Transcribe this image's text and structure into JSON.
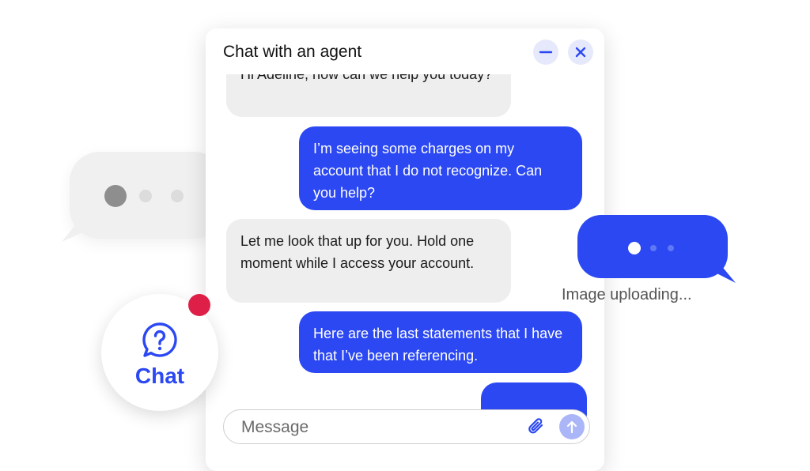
{
  "panel": {
    "title": "Chat with an agent",
    "minimize_icon": "minus-icon",
    "close_icon": "close-icon"
  },
  "messages": [
    {
      "from": "agent",
      "text": "Hi Adeline, how can we help you today?"
    },
    {
      "from": "user",
      "text": "I’m seeing some charges on my account that I do not recognize. Can you help?"
    },
    {
      "from": "agent",
      "text": "Let me look that up for you. Hold one moment while I access your account."
    },
    {
      "from": "user",
      "text": "Here are the last statements that I have that I’ve been referencing."
    },
    {
      "from": "user",
      "text": ""
    }
  ],
  "composer": {
    "placeholder": "Message",
    "attach_icon": "paperclip-icon",
    "send_icon": "arrow-up-icon"
  },
  "upload_status": "Image uploading...",
  "launcher": {
    "label": "Chat",
    "icon": "question-bubble-icon"
  },
  "colors": {
    "accent": "#2b48f2",
    "agent_bubble": "#eeeeee",
    "notification": "#de1f48"
  }
}
